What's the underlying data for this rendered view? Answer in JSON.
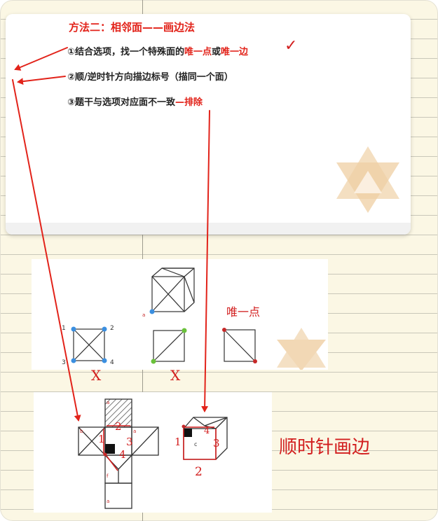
{
  "slide": {
    "title": "方法二：相邻面——画边法",
    "steps": [
      {
        "prefix": "①结合选项，找一个特殊面的",
        "em1": "唯一点",
        "mid": "或",
        "em2": "唯一边"
      },
      {
        "text": "②顺/逆时针方向描边标号（描同一个面）"
      },
      {
        "prefix": "③题干与选项对应面不一致",
        "em": "—排除"
      }
    ],
    "check_mark": "✓"
  },
  "options": {
    "cube_vertex_label": "a",
    "vertex_labels": [
      "1",
      "2",
      "3",
      "4"
    ],
    "verdicts": [
      "X",
      "X"
    ],
    "unique_point_note": "唯一点"
  },
  "net": {
    "face_labels": [
      "a",
      "b",
      "a",
      "f",
      "a"
    ],
    "handwritten_numbers": [
      "1",
      "2",
      "3",
      "4"
    ],
    "cube_face_label": "c",
    "cube_numbers": [
      "1",
      "2",
      "3",
      "4"
    ],
    "clockwise_note": "顺时针画边"
  },
  "colors": {
    "accent_red": "#e2231a",
    "ink_red": "#d21e1e",
    "blue_dot": "#3b8fe0",
    "green_dot": "#6ac13b"
  }
}
